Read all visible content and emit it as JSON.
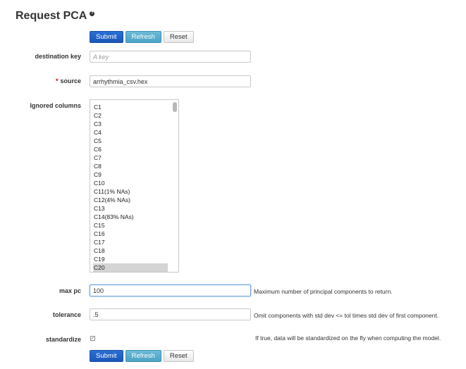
{
  "page": {
    "title": "Request PCA",
    "info_icon": "?"
  },
  "buttons": {
    "submit": "Submit",
    "refresh": "Refresh",
    "reset": "Reset"
  },
  "form": {
    "destination_key": {
      "label": "destination key",
      "value": "",
      "placeholder": "A key"
    },
    "source": {
      "label": "source",
      "required_mark": "*",
      "value": "arrhythmia_csv.hex"
    },
    "ignored_columns": {
      "label": "Ignored columns",
      "options": [
        "C1",
        "C2",
        "C3",
        "C4",
        "C5",
        "C6",
        "C7",
        "C8",
        "C9",
        "C10",
        "C11(1% NAs)",
        "C12(4% NAs)",
        "C13",
        "C14(83% NAs)",
        "C15",
        "C16",
        "C17",
        "C18",
        "C19",
        "C20"
      ],
      "selected": "C20"
    },
    "max_pc": {
      "label": "max pc",
      "value": "100",
      "hint": "Maximum number of principal components to return."
    },
    "tolerance": {
      "label": "tolerance",
      "value": ".5",
      "hint": "Omit components with std dev <= tol times std dev of first component."
    },
    "standardize": {
      "label": "standardize",
      "checked": true,
      "hint": "If true, data will be standardized on the fly when computing the model."
    }
  }
}
